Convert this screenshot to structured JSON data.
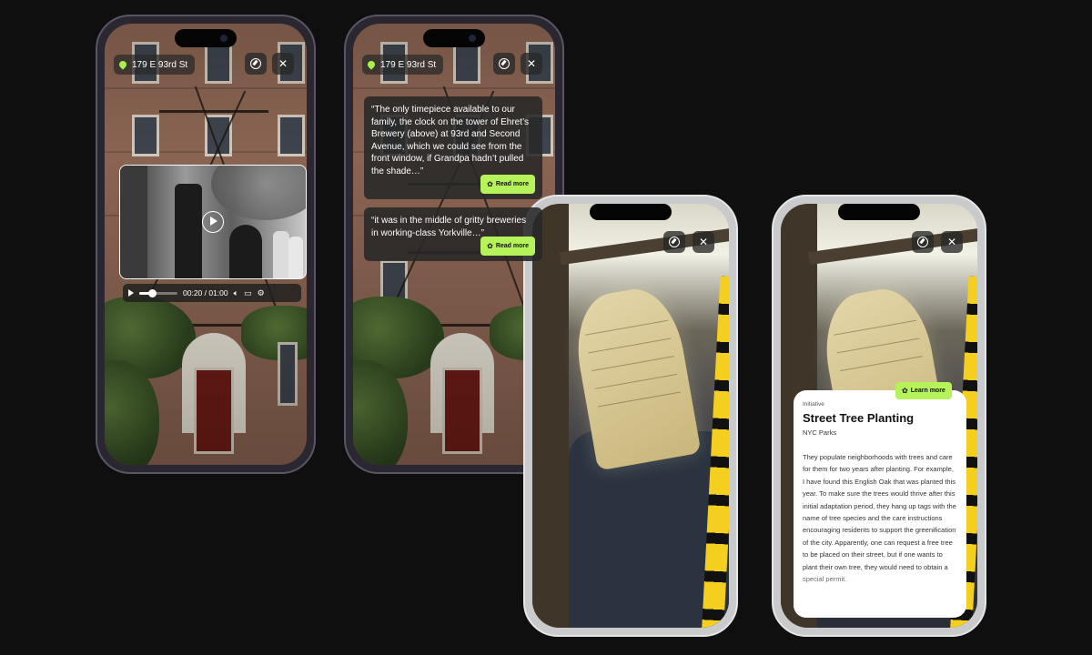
{
  "screens": {
    "video": {
      "location": "179 E 93rd St",
      "player": {
        "time": "00:20 / 01:00",
        "progress": 0.33
      }
    },
    "quotes": {
      "location": "179 E 93rd St",
      "quote1": "“The only timepiece available to our family, the clock on the tower of Ehret’s Brewery (above) at 93rd and Second Avenue, which we could see from the front window, if Grandpa hadn’t pulled the shade…”",
      "quote2": "“it was in the middle of gritty breweries in working-class Yorkville…”",
      "read_more": "Read more"
    },
    "tree_tag": {},
    "tree_info": {
      "kicker": "Initiative",
      "title": "Street Tree Planting",
      "org": "NYC Parks",
      "learn_more": "Learn more",
      "body": "They populate neighborhoods with trees and care for them for two years after planting. For example, I have found this English Oak that was planted this year. To make sure the trees would thrive after this initial adaptation period, they hang up tags with the name of tree species and the care instructions encouraging residents to support the greenification of the city. Apparently, one can request a free tree to be placed on their street, but if one wants to plant their own tree, they would need to obtain a special permit."
    }
  },
  "icons": [
    "location-pin-icon",
    "compass-icon",
    "close-icon",
    "play-icon",
    "volume-icon",
    "caption-icon",
    "settings-icon",
    "sprout-icon"
  ],
  "colors": {
    "accent": "#b6f25a",
    "background": "#0f0f10",
    "overlay": "#282828"
  }
}
